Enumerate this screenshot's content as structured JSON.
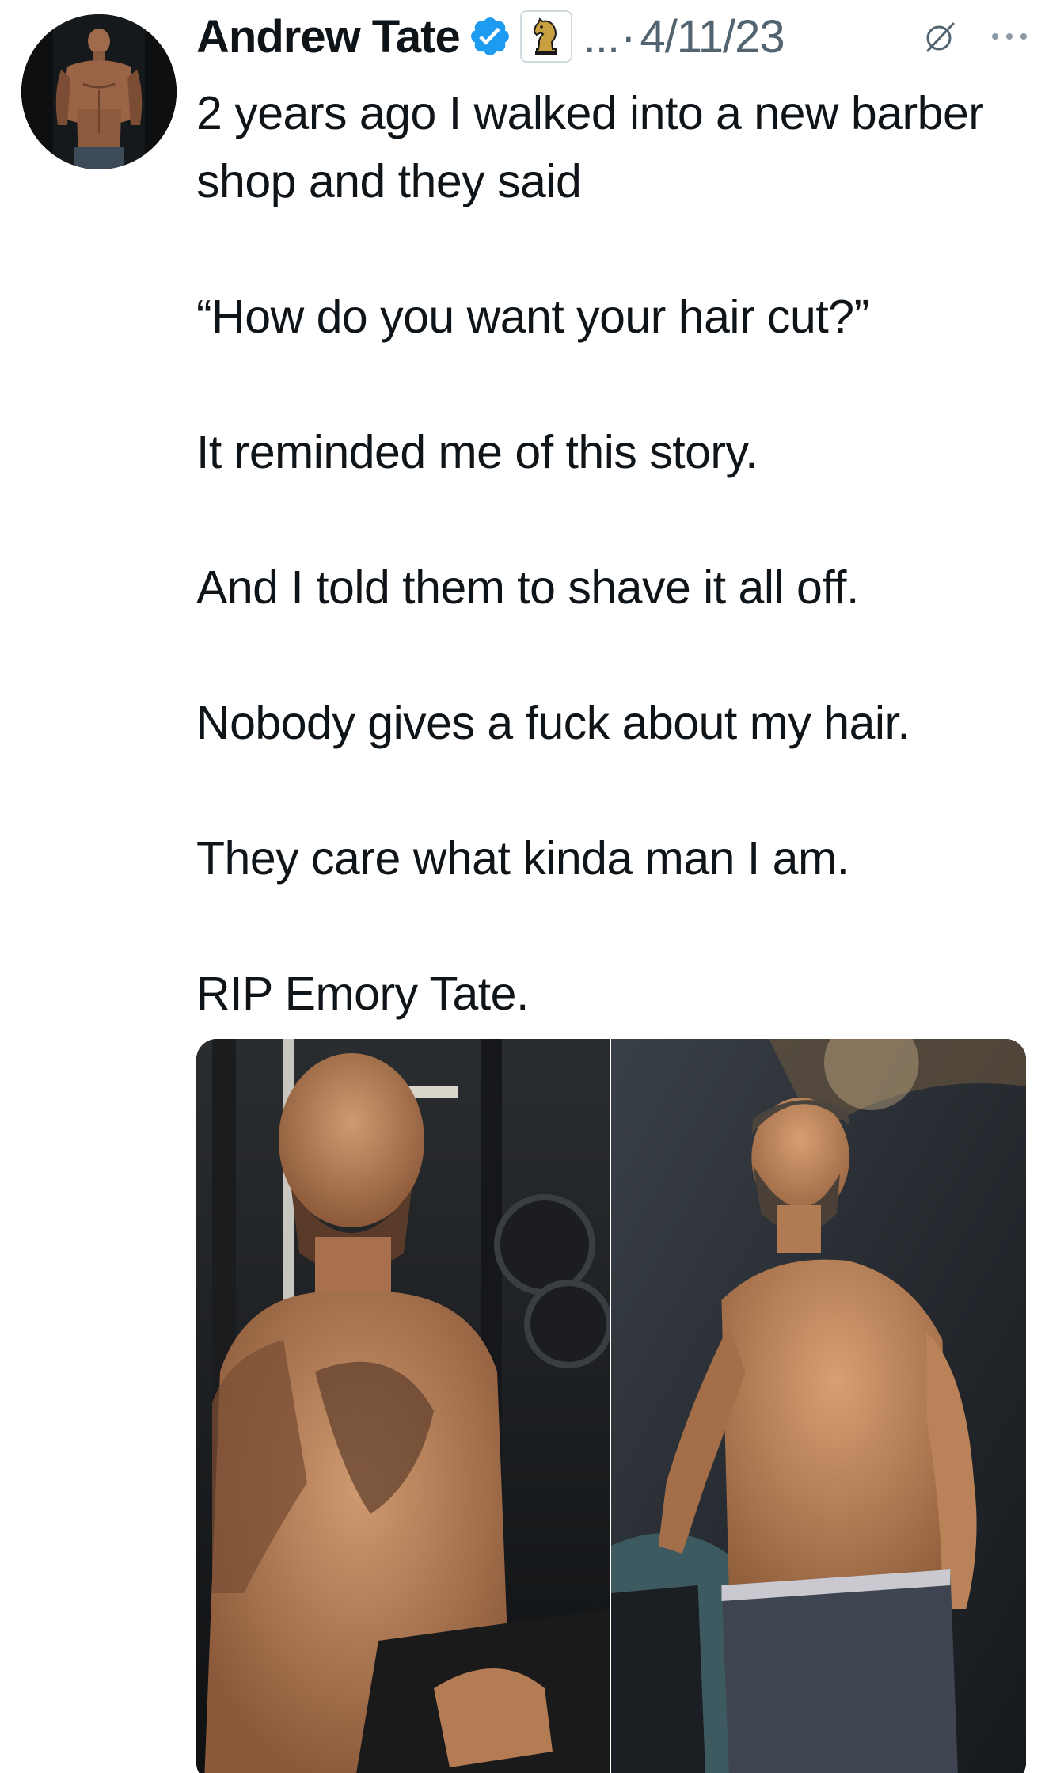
{
  "author": {
    "display_name": "Andrew Tate",
    "handle_truncated": "...",
    "separator": "·",
    "date": "4/11/23",
    "verified_icon": "verified-badge-icon",
    "affiliate_icon": "chess-knight-icon",
    "avatar_icon": "profile-photo"
  },
  "actions": {
    "mute_icon": "mute-icon",
    "more_icon": "more-options-icon"
  },
  "tweet": {
    "paragraphs": [
      "2 years ago I walked into a new barber shop and they said",
      "“How do you want your hair cut?”",
      "It reminded me of this story.",
      "And I told them to shave it all off.",
      "Nobody gives a fuck about my hair.",
      "They care what kinda man I am.",
      "RIP Emory Tate."
    ]
  },
  "media": {
    "photos": [
      "photo-bald-man-gym",
      "photo-bearded-man"
    ]
  },
  "colors": {
    "verified": "#1d9bf0",
    "secondary_text": "#536471",
    "primary_text": "#0f1419"
  }
}
